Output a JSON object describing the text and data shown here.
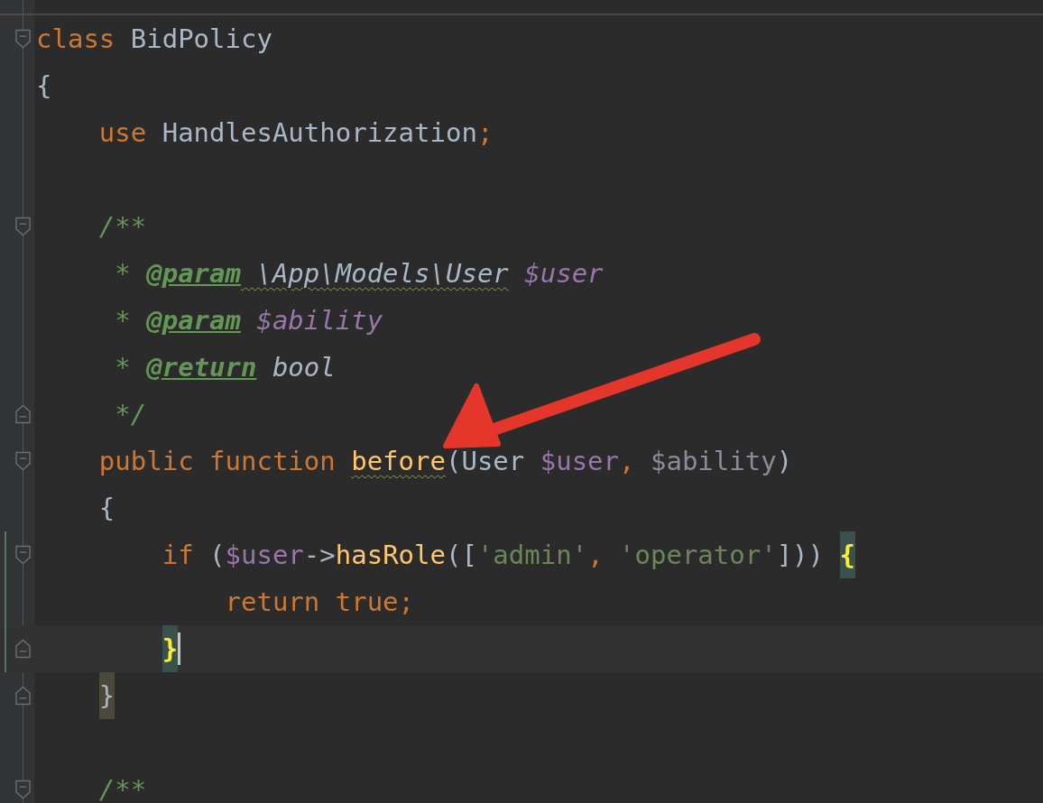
{
  "editor": {
    "lines": [
      {
        "current": false,
        "changed": false,
        "fold": {
          "kind": "open"
        },
        "tokens": [
          {
            "text": "class ",
            "kind": "keyword"
          },
          {
            "text": "BidPolicy",
            "kind": "plain"
          }
        ]
      },
      {
        "current": false,
        "changed": false,
        "tokens": [
          {
            "text": "{",
            "kind": "plain"
          }
        ]
      },
      {
        "current": false,
        "changed": false,
        "tokens": [
          {
            "text": "    use ",
            "kind": "keyword"
          },
          {
            "text": "HandlesAuthorization",
            "kind": "plain"
          },
          {
            "text": ";",
            "kind": "keyword"
          }
        ]
      },
      {
        "current": false,
        "changed": false
      },
      {
        "current": false,
        "changed": false,
        "fold": {
          "kind": "open"
        },
        "tokens": [
          {
            "text": "    /**",
            "kind": "comment"
          }
        ]
      },
      {
        "current": false,
        "changed": false,
        "tokens": [
          {
            "text": "     * ",
            "kind": "comment"
          },
          {
            "text": "@param",
            "kind": "doctag"
          },
          {
            "text": " \\App\\Models\\User",
            "kind": "doc-type",
            "squiggle": true
          },
          {
            "text": " $user",
            "kind": "doc-var"
          }
        ]
      },
      {
        "current": false,
        "changed": false,
        "tokens": [
          {
            "text": "     * ",
            "kind": "comment"
          },
          {
            "text": "@param",
            "kind": "doctag"
          },
          {
            "text": " $ability",
            "kind": "doc-var"
          }
        ]
      },
      {
        "current": false,
        "changed": false,
        "tokens": [
          {
            "text": "     * ",
            "kind": "comment"
          },
          {
            "text": "@return",
            "kind": "doctag"
          },
          {
            "text": " bool",
            "kind": "doc-type"
          }
        ]
      },
      {
        "current": false,
        "changed": false,
        "fold": {
          "kind": "close"
        },
        "tokens": [
          {
            "text": "     */",
            "kind": "comment"
          }
        ]
      },
      {
        "current": false,
        "changed": false,
        "fold": {
          "kind": "open"
        },
        "tokens": [
          {
            "text": "    public function ",
            "kind": "keyword"
          },
          {
            "text": "before",
            "kind": "function",
            "squiggle": true
          },
          {
            "text": "(User ",
            "kind": "plain"
          },
          {
            "text": "$user",
            "kind": "variable"
          },
          {
            "text": ", ",
            "kind": "keyword"
          },
          {
            "text": "$ability",
            "kind": "unused"
          },
          {
            "text": ")",
            "kind": "plain"
          }
        ]
      },
      {
        "current": false,
        "changed": false,
        "tokens": [
          {
            "text": "    {",
            "kind": "plain"
          }
        ]
      },
      {
        "current": false,
        "changed": true,
        "fold": {
          "kind": "open"
        },
        "tokens": [
          {
            "text": "        if ",
            "kind": "keyword"
          },
          {
            "text": "(",
            "kind": "plain"
          },
          {
            "text": "$user",
            "kind": "variable"
          },
          {
            "text": "->",
            "kind": "plain"
          },
          {
            "text": "hasRole",
            "kind": "function"
          },
          {
            "text": "([",
            "kind": "plain"
          },
          {
            "text": "'admin'",
            "kind": "string"
          },
          {
            "text": ", ",
            "kind": "keyword"
          },
          {
            "text": "'operator'",
            "kind": "string"
          },
          {
            "text": "])) ",
            "kind": "plain"
          },
          {
            "text": "{",
            "kind": "match"
          }
        ]
      },
      {
        "current": false,
        "changed": true,
        "tokens": [
          {
            "text": "            return true;",
            "kind": "keyword"
          }
        ]
      },
      {
        "current": true,
        "changed": true,
        "caret": true,
        "fold": {
          "kind": "close"
        },
        "tokens": [
          {
            "text": "        }",
            "kind": "match"
          }
        ]
      },
      {
        "current": false,
        "changed": false,
        "fold": {
          "kind": "close"
        },
        "tokens": [
          {
            "text": "    }",
            "kind": "brace-match"
          }
        ]
      },
      {
        "current": false,
        "changed": false
      },
      {
        "current": false,
        "changed": false,
        "fold": {
          "kind": "open"
        },
        "tokens": [
          {
            "text": "    /**",
            "kind": "comment"
          }
        ]
      }
    ]
  }
}
